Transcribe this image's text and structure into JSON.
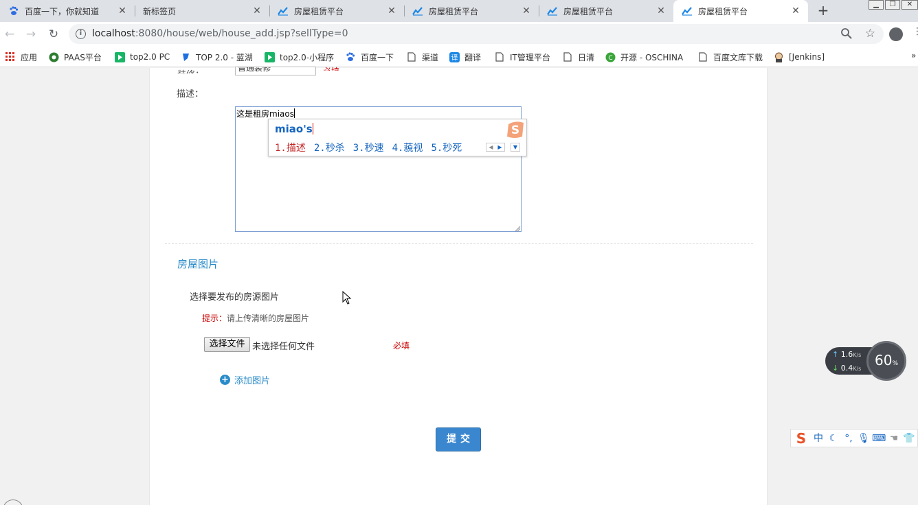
{
  "tabs": [
    {
      "title": "百度一下，你就知道",
      "icon": "baidu-paw-icon",
      "active": false
    },
    {
      "title": "新标签页",
      "icon": "none",
      "active": false
    },
    {
      "title": "房屋租赁平台",
      "icon": "chart-line-icon",
      "active": false
    },
    {
      "title": "房屋租赁平台",
      "icon": "chart-line-icon",
      "active": false
    },
    {
      "title": "房屋租赁平台",
      "icon": "chart-line-icon",
      "active": false
    },
    {
      "title": "房屋租赁平台",
      "icon": "chart-line-icon",
      "active": true
    }
  ],
  "toolbar": {
    "url_host": "localhost",
    "url_path": ":8080/house/web/house_add.jsp?sellType=0"
  },
  "bookmarks": [
    {
      "label": "应用",
      "icon": "apps-grid-icon"
    },
    {
      "label": "PAAS平台",
      "icon": "paas-icon"
    },
    {
      "label": "top2.0 PC",
      "icon": "play-green-icon"
    },
    {
      "label": "TOP 2.0 - 蓝湖",
      "icon": "lanhu-icon"
    },
    {
      "label": "top2.0-小程序",
      "icon": "play-green-icon"
    },
    {
      "label": "百度一下",
      "icon": "baidu-paw-icon"
    },
    {
      "label": "渠道",
      "icon": "page-icon"
    },
    {
      "label": "翻译",
      "icon": "translate-icon"
    },
    {
      "label": "IT管理平台",
      "icon": "page-icon"
    },
    {
      "label": "日清",
      "icon": "page-icon"
    },
    {
      "label": "开源 - OSCHINA",
      "icon": "oschina-icon"
    },
    {
      "label": "百度文库下载",
      "icon": "page-icon"
    },
    {
      "label": "[Jenkins]",
      "icon": "jenkins-icon"
    }
  ],
  "bookmarks_more": "»",
  "form": {
    "cut_label": "装修：",
    "cut_value": "普通装修",
    "cut_required": "必填",
    "desc_label": "描述：",
    "desc_value": "这是租房miaos",
    "section_title": "房屋图片",
    "pick_label": "选择要发布的房源图片",
    "tip_key": "提示：",
    "tip_text": "请上传清晰的房屋图片",
    "file_button": "选择文件",
    "file_status": "未选择任何文件",
    "required": "必填",
    "add_picture": "添加图片",
    "submit": "提交"
  },
  "ime": {
    "composition": "miao's",
    "candidates": [
      "1.描述",
      "2.秒杀",
      "3.秒速",
      "4.藐视",
      "5.秒死"
    ]
  },
  "network": {
    "up": "1.6",
    "down": "0.4",
    "unit": "K/s",
    "percent": "60",
    "percent_sign": "%"
  },
  "ime_bar": {
    "mode": "中"
  },
  "colors": {
    "accent": "#2a8bc9",
    "required": "#cc0000",
    "submit": "#3b87cf"
  }
}
